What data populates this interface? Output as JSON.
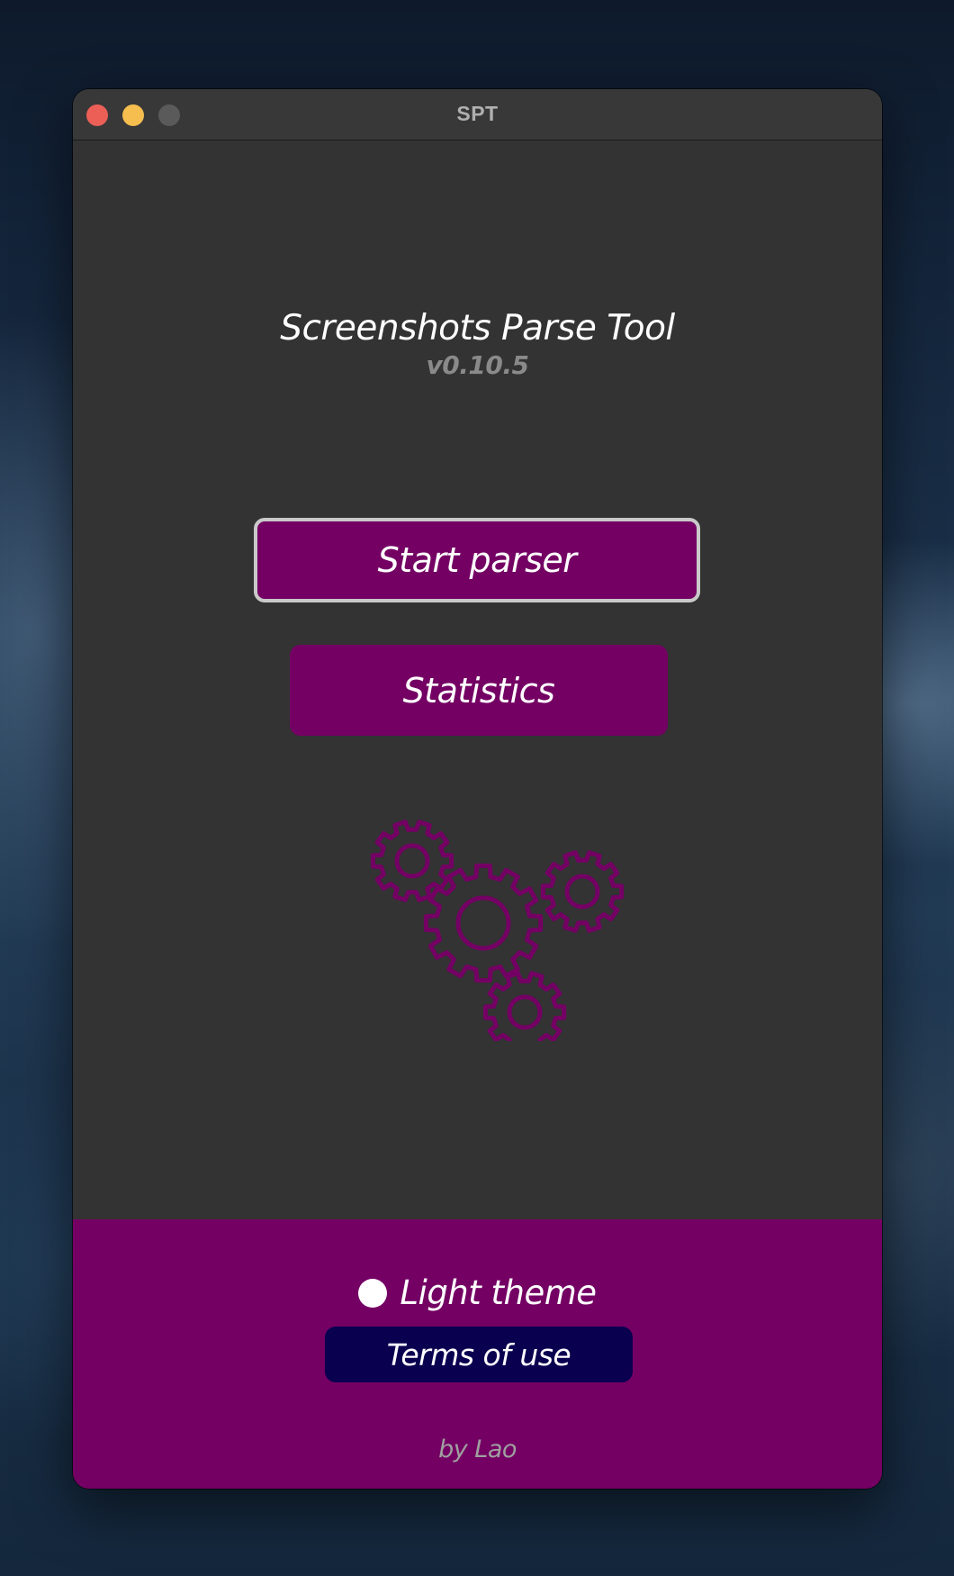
{
  "window": {
    "title": "SPT"
  },
  "main": {
    "app_title": "Screenshots Parse Tool",
    "version": "v0.10.5",
    "start_button_label": "Start parser",
    "statistics_button_label": "Statistics",
    "illustration_icon": "gears-icon"
  },
  "footer": {
    "theme_toggle_label": "Light theme",
    "theme_toggle_selected": false,
    "terms_button_label": "Terms of use",
    "author": "by Lao"
  },
  "colors": {
    "window_background": "#333333",
    "accent_purple": "#740064",
    "terms_button_navy": "#0a0050",
    "version_gray": "#8a8a8a"
  }
}
